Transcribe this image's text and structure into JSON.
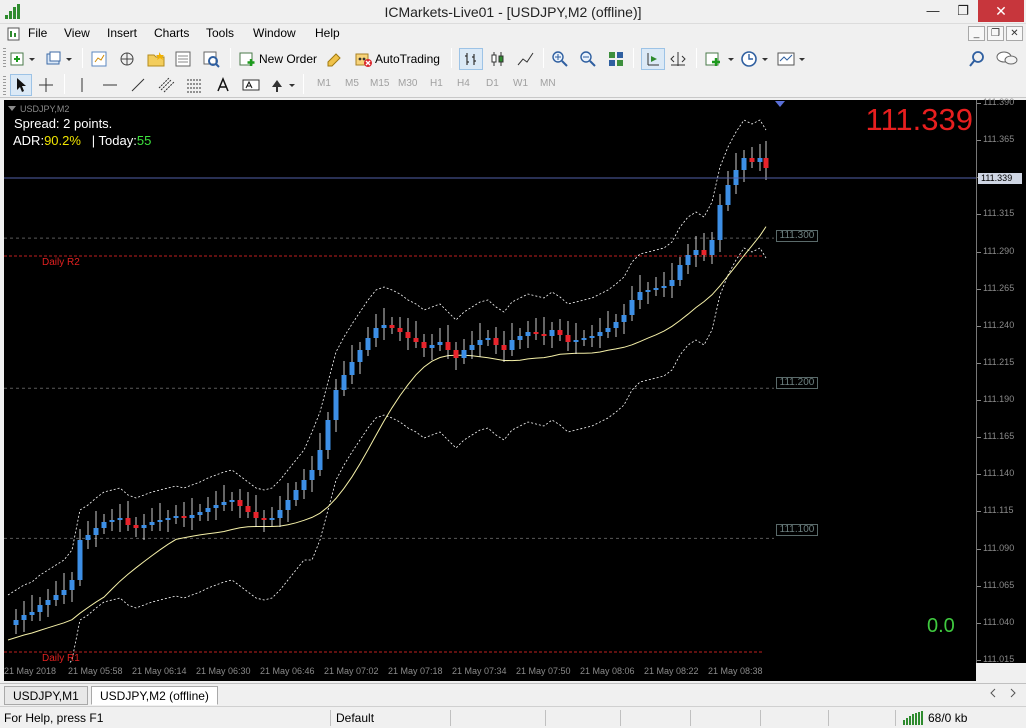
{
  "window": {
    "title": "ICMarkets-Live01 - [USDJPY,M2 (offline)]",
    "minimize": "—",
    "restore": "❐",
    "close": "✕"
  },
  "menu": {
    "items": [
      "File",
      "View",
      "Insert",
      "Charts",
      "Tools",
      "Window",
      "Help"
    ],
    "mdi_min": "_",
    "mdi_restore": "❐",
    "mdi_close": "✕"
  },
  "toolbar": {
    "new_order": "New Order",
    "auto_trading": "AutoTrading",
    "timeframes": [
      "M1",
      "M5",
      "M15",
      "M30",
      "H1",
      "H4",
      "D1",
      "W1",
      "MN"
    ]
  },
  "chart": {
    "symbol_label": "USDJPY,M2",
    "spread_text": "Spread: 2 points.",
    "adr_label": "ADR:",
    "adr_value": "90.2%",
    "today_label": "| Today:",
    "today_value": "55",
    "big_price": "111.339",
    "bottom_value": "0.0",
    "pivot_r2": "Daily R2",
    "pivot_r1": "Daily R1",
    "level_labels": [
      "111.300",
      "111.200",
      "111.100"
    ],
    "price_labels": [
      "111.390",
      "111.365",
      "111.339",
      "111.315",
      "111.290",
      "111.265",
      "111.240",
      "111.215",
      "111.190",
      "111.165",
      "111.140",
      "111.115",
      "111.090",
      "111.065",
      "111.040",
      "111.015"
    ],
    "current_price_tag": "111.339",
    "time_labels": [
      "21 May 2018",
      "21 May 05:58",
      "21 May 06:14",
      "21 May 06:30",
      "21 May 06:46",
      "21 May 07:02",
      "21 May 07:18",
      "21 May 07:34",
      "21 May 07:50",
      "21 May 08:06",
      "21 May 08:22",
      "21 May 08:38"
    ],
    "colors": {
      "background": "#000000",
      "bull": "#3d8fe6",
      "bear": "#e8242c",
      "wick": "#ffffff",
      "ma": "#f5f0a8",
      "band": "#ffffff",
      "price_line": "#5260a8",
      "pivot": "#c02020",
      "level_grid": "#5a5a5a"
    }
  },
  "tabs": [
    "USDJPY,M1",
    "USDJPY,M2 (offline)"
  ],
  "status": {
    "help": "For Help, press F1",
    "profile": "Default",
    "traffic": "68/0 kb"
  }
}
